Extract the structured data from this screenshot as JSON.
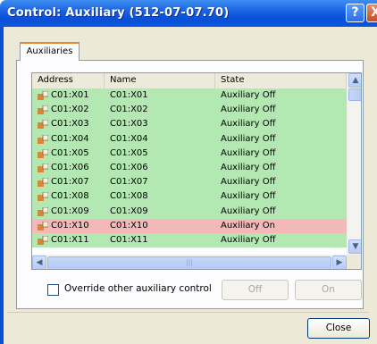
{
  "window": {
    "title": "Control: Auxiliary (512-07-07.70)",
    "help_glyph": "?",
    "close_glyph": "X"
  },
  "tabs": [
    {
      "label": "Auxiliaries",
      "active": true
    }
  ],
  "table": {
    "columns": [
      "Address",
      "Name",
      "State"
    ],
    "rows": [
      {
        "address": "C01:X01",
        "name": "C01:X01",
        "state": "Auxiliary Off",
        "status": "off"
      },
      {
        "address": "C01:X02",
        "name": "C01:X02",
        "state": "Auxiliary Off",
        "status": "off"
      },
      {
        "address": "C01:X03",
        "name": "C01:X03",
        "state": "Auxiliary Off",
        "status": "off"
      },
      {
        "address": "C01:X04",
        "name": "C01:X04",
        "state": "Auxiliary Off",
        "status": "off"
      },
      {
        "address": "C01:X05",
        "name": "C01:X05",
        "state": "Auxiliary Off",
        "status": "off"
      },
      {
        "address": "C01:X06",
        "name": "C01:X06",
        "state": "Auxiliary Off",
        "status": "off"
      },
      {
        "address": "C01:X07",
        "name": "C01:X07",
        "state": "Auxiliary Off",
        "status": "off"
      },
      {
        "address": "C01:X08",
        "name": "C01:X08",
        "state": "Auxiliary Off",
        "status": "off"
      },
      {
        "address": "C01:X09",
        "name": "C01:X09",
        "state": "Auxiliary Off",
        "status": "off"
      },
      {
        "address": "C01:X10",
        "name": "C01:X10",
        "state": "Auxiliary On",
        "status": "on"
      },
      {
        "address": "C01:X11",
        "name": "C01:X11",
        "state": "Auxiliary Off",
        "status": "off"
      }
    ],
    "row_icon": "auxiliary-device-icon"
  },
  "colors": {
    "row_off": "#b3e8b3",
    "row_on": "#f4b8b8",
    "titlebar": "#0a4fd8"
  },
  "controls": {
    "override_label": "Override other auxiliary control",
    "override_checked": false,
    "off_label": "Off",
    "on_label": "On",
    "close_label": "Close"
  }
}
